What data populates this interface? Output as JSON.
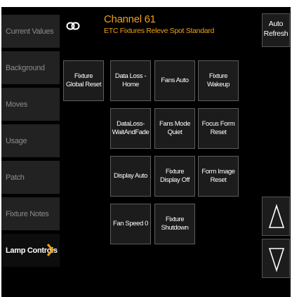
{
  "sidebar": {
    "items": [
      {
        "label": "Current Values"
      },
      {
        "label": "Background"
      },
      {
        "label": "Moves"
      },
      {
        "label": "Usage"
      },
      {
        "label": "Patch"
      },
      {
        "label": "Fixture Notes"
      },
      {
        "label": "Lamp Controls",
        "active": true
      }
    ]
  },
  "header": {
    "icon": "link-icon",
    "channel_title": "Channel 61",
    "fixture_type": "ETC Fixtures Releve Spot Standard"
  },
  "toolbar": {
    "auto_refresh_line1": "Auto",
    "auto_refresh_line2": "Refresh"
  },
  "lamp_controls": {
    "fixture_global_reset": "Fixture Global Reset",
    "data_loss_home": "Data Loss - Home",
    "fans_auto": "Fans Auto",
    "fixture_wakeup": "Fixture Wakeup",
    "dataloss_wait_line1": "DataLoss-",
    "dataloss_wait_line2": "WaitAndFade",
    "fans_mode_quiet": "Fans Mode Quiet",
    "focus_form_reset": "Focus Form Reset",
    "display_auto": "Display Auto",
    "fixture_display_off": "Fixture Display Off",
    "form_image_reset": "Form Image Reset",
    "fan_speed_0": "Fan Speed 0",
    "fixture_shutdown": "Fixture Shutdown"
  },
  "colors": {
    "accent": "#f0a015",
    "panel_bg": "#000000",
    "button_bg": "#1c1c1c",
    "button_border": "#5e5e5e"
  },
  "scroll": {
    "up_icon": "triangle-up-icon",
    "down_icon": "triangle-down-icon"
  }
}
